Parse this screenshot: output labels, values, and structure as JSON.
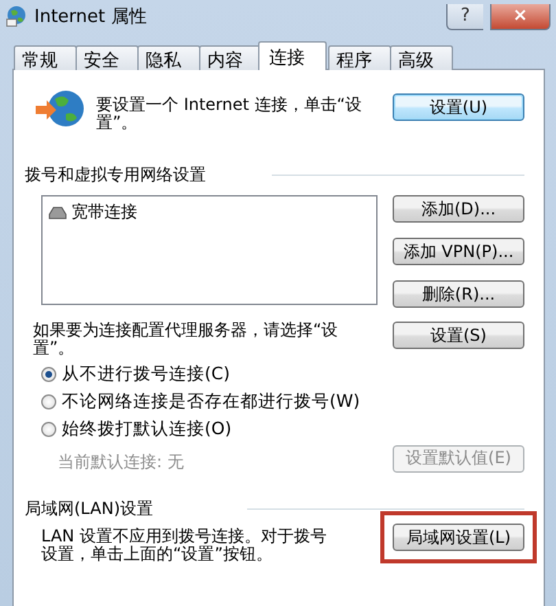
{
  "window": {
    "title": "Internet 属性",
    "help": "?",
    "close": "×"
  },
  "tabs": [
    {
      "label": "常规",
      "selected": false
    },
    {
      "label": "安全",
      "selected": false
    },
    {
      "label": "隐私",
      "selected": false
    },
    {
      "label": "内容",
      "selected": false
    },
    {
      "label": "连接",
      "selected": true
    },
    {
      "label": "程序",
      "selected": false
    },
    {
      "label": "高级",
      "selected": false
    }
  ],
  "setup": {
    "text": "要设置一个 Internet 连接，单击“设置”。",
    "button": {
      "label": "设置(U)",
      "focused": true
    }
  },
  "dialup": {
    "heading": "拨号和虚拟专用网络设置",
    "connections": [
      {
        "name": "宽带连接"
      }
    ],
    "buttons": [
      {
        "label": "添加(D)...",
        "disabled": false
      },
      {
        "label": "添加 VPN(P)...",
        "disabled": false
      },
      {
        "label": "删除(R)...",
        "disabled": false
      }
    ],
    "proxy_text": "如果要为连接配置代理服务器，请选择“设置”。",
    "proxy_button": {
      "label": "设置(S)",
      "disabled": false
    },
    "options": [
      {
        "label": "从不进行拨号连接(C)",
        "selected": true
      },
      {
        "label": "不论网络连接是否存在都进行拨号(W)",
        "selected": false
      },
      {
        "label": "始终拨打默认连接(O)",
        "selected": false
      }
    ],
    "default_connection": {
      "text": "当前默认连接: 无",
      "disabled": true
    },
    "default_button": {
      "label": "设置默认值(E)",
      "disabled": true
    }
  },
  "lan": {
    "heading": "局域网(LAN)设置",
    "text": "LAN 设置不应用到拨号连接。对于拨号设置，单击上面的“设置”按钮。",
    "button": {
      "label": "局域网设置(L)",
      "highlighted": true
    }
  }
}
